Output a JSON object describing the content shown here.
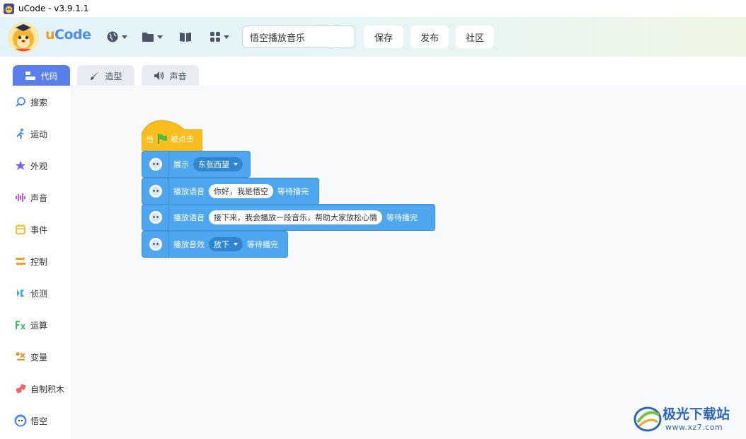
{
  "window": {
    "title": "uCode - v3.9.1.1"
  },
  "header": {
    "logo_u": "u",
    "logo_code": "Code",
    "project_name": "悟空播放音乐",
    "save_label": "保存",
    "publish_label": "发布",
    "community_label": "社区"
  },
  "tabs": [
    {
      "label": "代码",
      "active": true
    },
    {
      "label": "造型",
      "active": false
    },
    {
      "label": "声音",
      "active": false
    }
  ],
  "categories": [
    {
      "label": "搜索",
      "icon": "search-icon",
      "color": "#4a8cf5"
    },
    {
      "label": "运动",
      "icon": "motion-icon",
      "color": "#4a8cf5"
    },
    {
      "label": "外观",
      "icon": "looks-icon",
      "color": "#7b61ff"
    },
    {
      "label": "声音",
      "icon": "sound-icon",
      "color": "#c45bd6"
    },
    {
      "label": "事件",
      "icon": "event-icon",
      "color": "#f5b91f"
    },
    {
      "label": "控制",
      "icon": "control-icon",
      "color": "#f59e1f"
    },
    {
      "label": "侦测",
      "icon": "sensing-icon",
      "color": "#3bb0e8"
    },
    {
      "label": "运算",
      "icon": "operator-icon",
      "color": "#3bbf6a"
    },
    {
      "label": "变量",
      "icon": "variable-icon",
      "color": "#f58a1f"
    },
    {
      "label": "自制积木",
      "icon": "custom-block-icon",
      "color": "#f2646a"
    },
    {
      "label": "悟空",
      "icon": "wukong-icon",
      "color": "#4a8cf5"
    }
  ],
  "blocks": {
    "hat": {
      "prefix": "当",
      "suffix": "被点击"
    },
    "show": {
      "label": "展示",
      "option": "东张西望"
    },
    "speak1": {
      "label": "播放语音",
      "text": "你好，我是悟空",
      "suffix": "等待播完"
    },
    "speak2": {
      "label": "播放语音",
      "text": "接下来，我会播放一段音乐，帮助大家放松心情",
      "suffix": "等待播完"
    },
    "sound": {
      "label": "播放音效",
      "option": "放下",
      "suffix": "等待播完"
    }
  },
  "watermark": {
    "title": "极光下载站",
    "url": "www.xz7.com"
  },
  "colors": {
    "block_blue": "#4ea7ee",
    "hat_yellow": "#f9bd1e",
    "tab_active": "#5b7fea"
  }
}
